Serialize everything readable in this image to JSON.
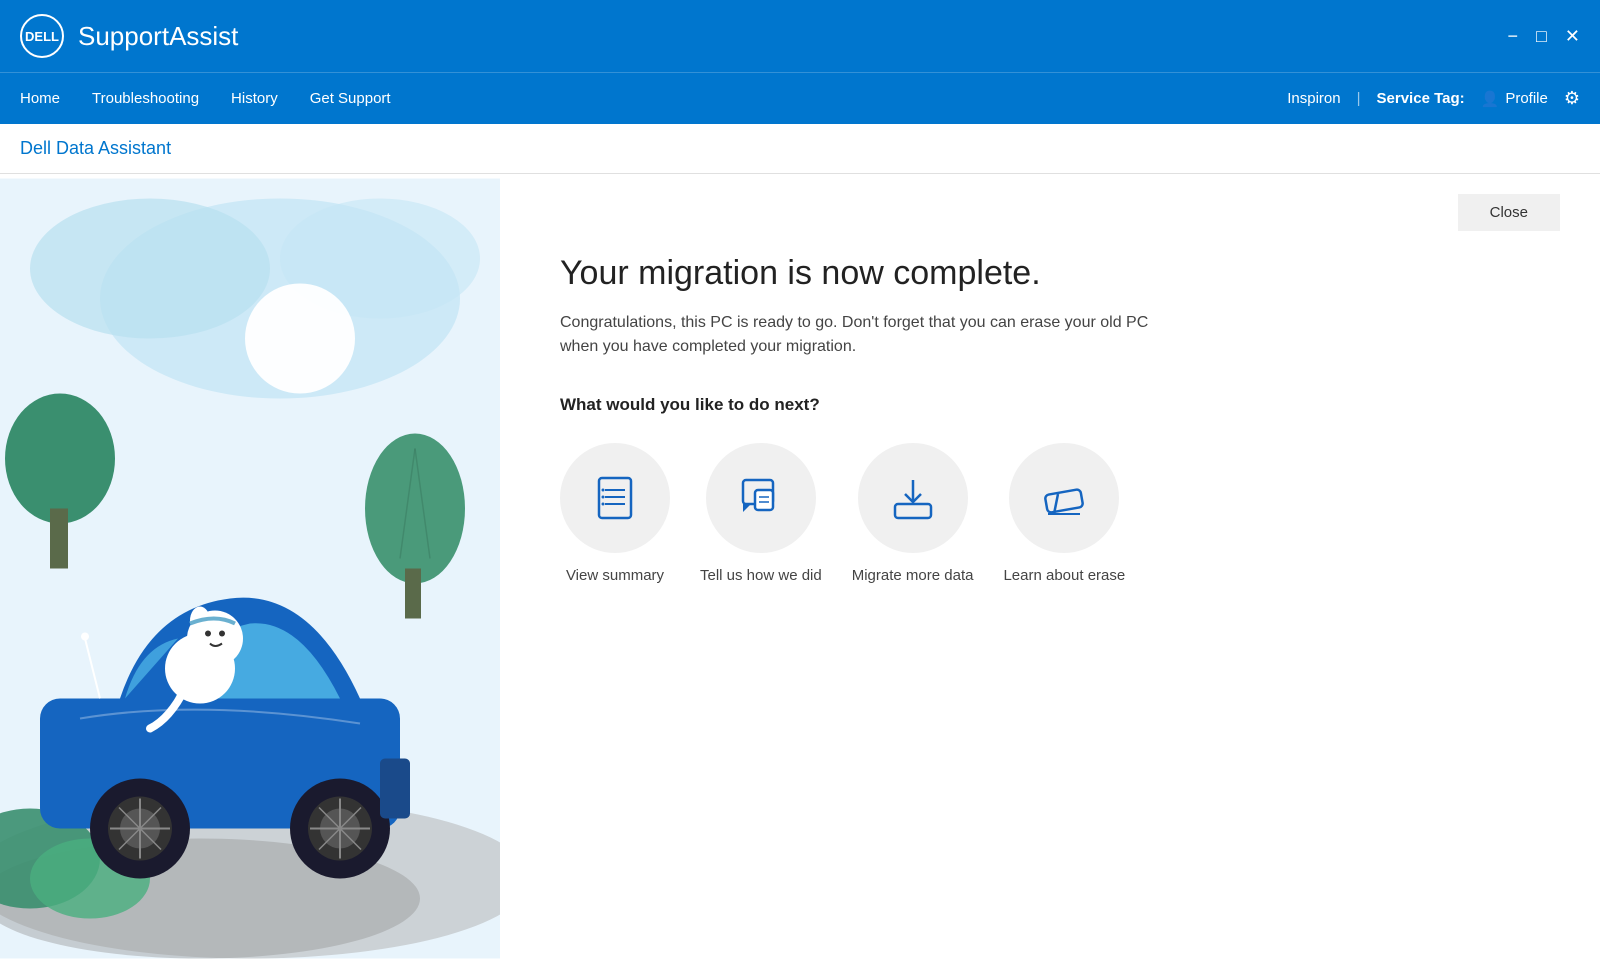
{
  "titleBar": {
    "logo_text": "DELL",
    "app_title": "SupportAssist",
    "minimize_label": "−",
    "maximize_label": "□",
    "close_label": "✕"
  },
  "navBar": {
    "links": [
      {
        "id": "home",
        "label": "Home"
      },
      {
        "id": "troubleshooting",
        "label": "Troubleshooting"
      },
      {
        "id": "history",
        "label": "History"
      },
      {
        "id": "get-support",
        "label": "Get Support"
      }
    ],
    "device": "Inspiron",
    "divider": "|",
    "service_tag_label": "Service Tag:",
    "profile_label": "Profile",
    "settings_icon": "⚙"
  },
  "pageHeader": {
    "title": "Dell Data Assistant"
  },
  "main": {
    "close_button": "Close",
    "migration_title": "Your migration is now complete.",
    "migration_desc": "Congratulations, this PC is ready to go. Don't forget that you can erase your old PC when you have completed your migration.",
    "next_label": "What would you like to do next?",
    "actions": [
      {
        "id": "view-summary",
        "label": "View summary",
        "icon": "summary"
      },
      {
        "id": "tell-us",
        "label": "Tell us how we did",
        "icon": "feedback"
      },
      {
        "id": "migrate-more",
        "label": "Migrate more data",
        "icon": "migrate"
      },
      {
        "id": "learn-erase",
        "label": "Learn about erase",
        "icon": "erase"
      }
    ]
  }
}
